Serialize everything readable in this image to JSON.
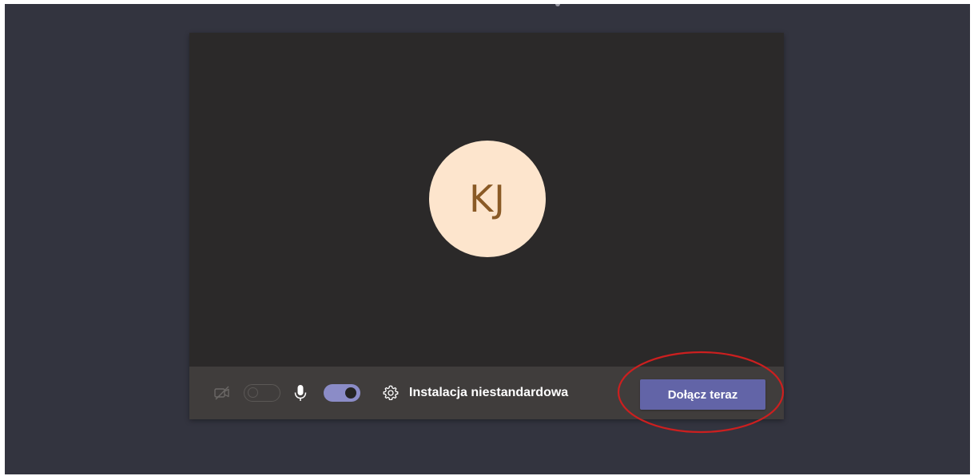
{
  "avatar": {
    "initials": "KJ",
    "background_color": "#fde5cd",
    "text_color": "#8a5a26"
  },
  "controls": {
    "camera": {
      "icon": "camera-off-icon",
      "enabled": false
    },
    "microphone": {
      "icon": "microphone-icon",
      "enabled": true
    },
    "settings": {
      "icon": "gear-icon",
      "label": "Instalacja niestandardowa"
    },
    "join_button": {
      "label": "Dołącz teraz",
      "color": "#6264a7"
    }
  },
  "annotation": {
    "type": "ellipse",
    "color": "#cc1f1f"
  },
  "colors": {
    "page_background": "#33343f",
    "card_background": "#2b2929",
    "controls_background": "#403d3c",
    "toggle_on": "#8b8cc7"
  }
}
